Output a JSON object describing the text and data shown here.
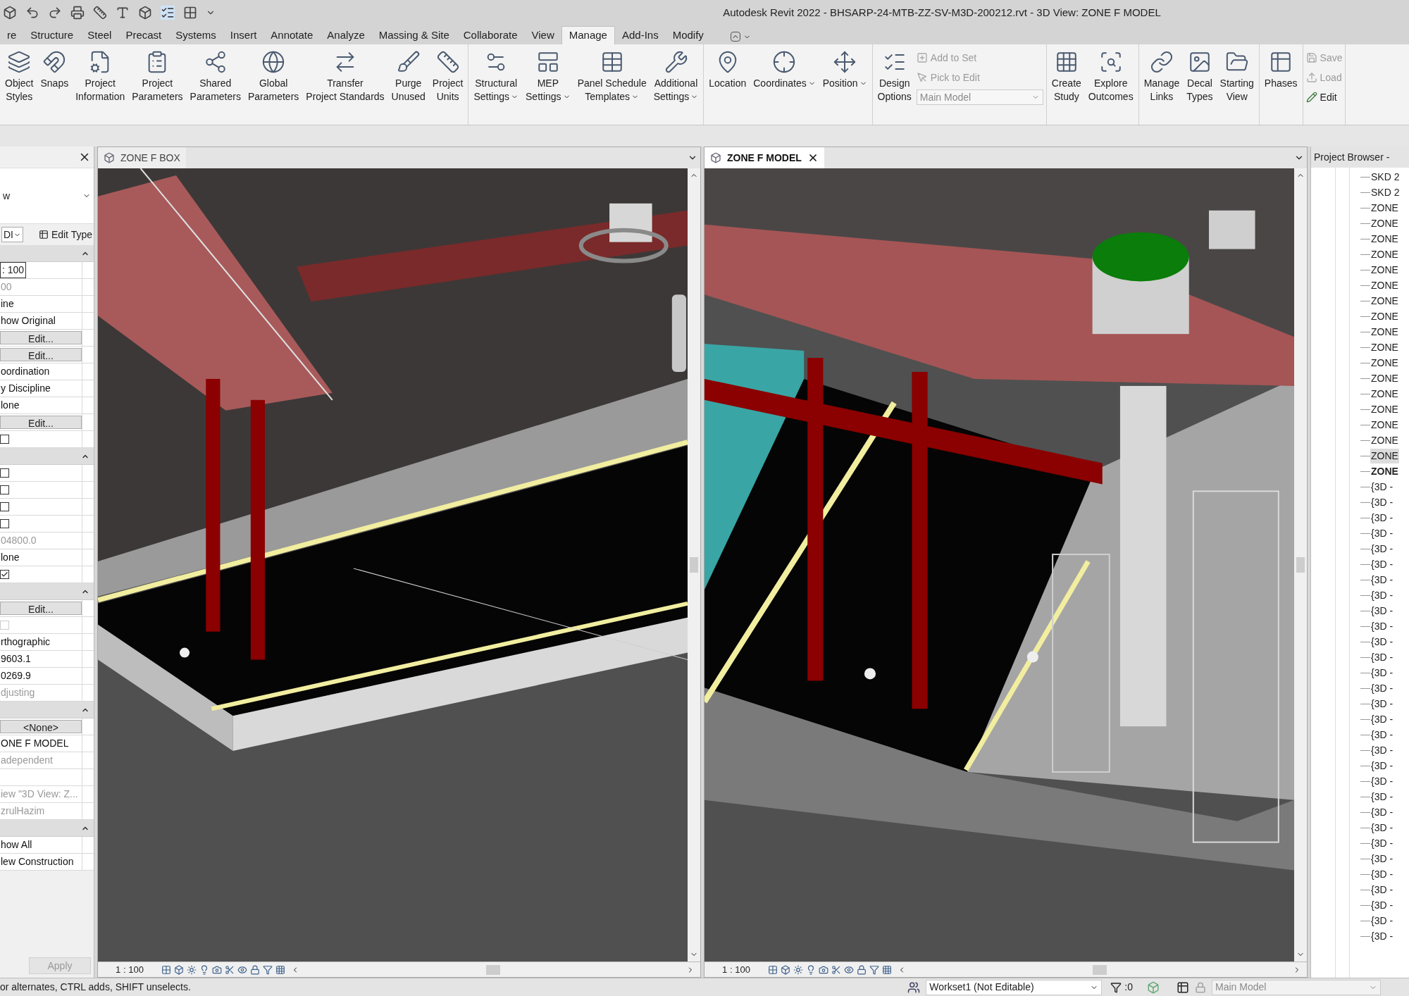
{
  "window": {
    "title": "Autodesk Revit 2022 - BHSARP-24-MTB-ZZ-SV-M3D-200212.rvt - 3D View: ZONE F MODEL"
  },
  "ribbon": {
    "tabs": [
      {
        "label": "re",
        "selected": false
      },
      {
        "label": "Structure",
        "selected": false
      },
      {
        "label": "Steel",
        "selected": false
      },
      {
        "label": "Precast",
        "selected": false
      },
      {
        "label": "Systems",
        "selected": false
      },
      {
        "label": "Insert",
        "selected": false
      },
      {
        "label": "Annotate",
        "selected": false
      },
      {
        "label": "Analyze",
        "selected": false
      },
      {
        "label": "Massing & Site",
        "selected": false
      },
      {
        "label": "Collaborate",
        "selected": false
      },
      {
        "label": "View",
        "selected": false
      },
      {
        "label": "Manage",
        "selected": true
      },
      {
        "label": "Add-Ins",
        "selected": false
      },
      {
        "label": "Modify",
        "selected": false
      }
    ],
    "panels": [
      {
        "items": [
          {
            "kind": "large",
            "lines": [
              "Object",
              "Styles"
            ],
            "dropdown": false
          },
          {
            "kind": "large",
            "lines": [
              "Snaps"
            ],
            "dropdown": false
          },
          {
            "kind": "large",
            "lines": [
              "Project",
              "Information"
            ],
            "dropdown": false
          },
          {
            "kind": "large",
            "lines": [
              "Project",
              "Parameters"
            ],
            "dropdown": false
          },
          {
            "kind": "large",
            "lines": [
              "Shared",
              "Parameters"
            ],
            "dropdown": false
          },
          {
            "kind": "large",
            "lines": [
              "Global",
              "Parameters"
            ],
            "dropdown": false
          },
          {
            "kind": "large",
            "lines": [
              "Transfer",
              "Project Standards"
            ],
            "dropdown": false
          },
          {
            "kind": "large",
            "lines": [
              "Purge",
              "Unused"
            ],
            "dropdown": false
          },
          {
            "kind": "large",
            "lines": [
              "Project",
              "Units"
            ],
            "dropdown": false
          }
        ]
      },
      {
        "items": [
          {
            "kind": "large",
            "lines": [
              "Structural",
              "Settings"
            ],
            "dropdown": true
          },
          {
            "kind": "large",
            "lines": [
              "MEP",
              "Settings"
            ],
            "dropdown": true
          },
          {
            "kind": "large",
            "lines": [
              "Panel Schedule",
              "Templates"
            ],
            "dropdown": true
          },
          {
            "kind": "large",
            "lines": [
              "Additional",
              "Settings"
            ],
            "dropdown": true
          }
        ]
      },
      {
        "items": [
          {
            "kind": "large",
            "lines": [
              "Location"
            ],
            "dropdown": false
          },
          {
            "kind": "large",
            "lines": [
              "Coordinates"
            ],
            "dropdown": true
          },
          {
            "kind": "large",
            "lines": [
              "Position"
            ],
            "dropdown": true
          }
        ]
      },
      {
        "items": [
          {
            "kind": "large",
            "lines": [
              "Design",
              "Options"
            ],
            "dropdown": false
          },
          {
            "kind": "small",
            "label": "Add to Set",
            "disabled": true
          },
          {
            "kind": "small",
            "label": "Pick to Edit",
            "disabled": true
          },
          {
            "kind": "select",
            "value": "Main Model",
            "disabled": true
          }
        ]
      },
      {
        "items": [
          {
            "kind": "large",
            "lines": [
              "Create",
              "Study"
            ],
            "dropdown": false
          },
          {
            "kind": "large",
            "lines": [
              "Explore",
              "Outcomes"
            ],
            "dropdown": false
          }
        ]
      },
      {
        "items": [
          {
            "kind": "large",
            "lines": [
              "Manage",
              "Links"
            ],
            "dropdown": false
          },
          {
            "kind": "large",
            "lines": [
              "Decal",
              "Types"
            ],
            "dropdown": false
          },
          {
            "kind": "large",
            "lines": [
              "Starting",
              "View"
            ],
            "dropdown": false
          }
        ]
      },
      {
        "items": [
          {
            "kind": "large",
            "lines": [
              "Phases"
            ],
            "dropdown": false
          }
        ]
      },
      {
        "items": [
          {
            "kind": "small",
            "label": "Save",
            "disabled": true
          },
          {
            "kind": "small",
            "label": "Load",
            "disabled": true
          },
          {
            "kind": "small",
            "label": "Edit",
            "disabled": false
          }
        ]
      }
    ]
  },
  "properties": {
    "type_selector": "w",
    "instance_selector": "DI",
    "edit_type": "Edit Type",
    "sections": [
      {
        "rows": [
          {
            "kind": "input",
            "value": ": 100"
          },
          {
            "kind": "text",
            "value": "00",
            "disabled": true
          },
          {
            "kind": "text",
            "value": "ine",
            "disabled": false
          },
          {
            "kind": "text",
            "value": "how Original",
            "disabled": false
          },
          {
            "kind": "button",
            "value": "Edit..."
          },
          {
            "kind": "button",
            "value": "Edit..."
          },
          {
            "kind": "text",
            "value": "oordination",
            "disabled": false
          },
          {
            "kind": "text",
            "value": "y Discipline",
            "disabled": false
          },
          {
            "kind": "text",
            "value": "lone",
            "disabled": false
          },
          {
            "kind": "button",
            "value": "Edit..."
          },
          {
            "kind": "checkbox",
            "checked": false,
            "disabled": false
          }
        ]
      },
      {
        "rows": [
          {
            "kind": "checkbox",
            "checked": false,
            "disabled": false
          },
          {
            "kind": "checkbox",
            "checked": false,
            "disabled": false
          },
          {
            "kind": "checkbox",
            "checked": false,
            "disabled": false
          },
          {
            "kind": "checkbox",
            "checked": false,
            "disabled": false
          },
          {
            "kind": "text",
            "value": "04800.0",
            "disabled": true
          },
          {
            "kind": "text",
            "value": "lone",
            "disabled": false
          },
          {
            "kind": "checkbox",
            "checked": true,
            "disabled": false
          }
        ]
      },
      {
        "rows": [
          {
            "kind": "button",
            "value": "Edit..."
          },
          {
            "kind": "checkbox",
            "checked": false,
            "disabled": true
          },
          {
            "kind": "text",
            "value": "rthographic",
            "disabled": false
          },
          {
            "kind": "text",
            "value": "9603.1",
            "disabled": false
          },
          {
            "kind": "text",
            "value": "0269.9",
            "disabled": false
          },
          {
            "kind": "text",
            "value": "djusting",
            "disabled": true
          }
        ]
      },
      {
        "rows": [
          {
            "kind": "button",
            "value": "<None>"
          },
          {
            "kind": "text",
            "value": "ONE F MODEL",
            "disabled": false
          },
          {
            "kind": "text",
            "value": "adependent",
            "disabled": true
          },
          {
            "kind": "empty"
          },
          {
            "kind": "text",
            "value": "iew \"3D View: Z...",
            "disabled": true
          },
          {
            "kind": "text",
            "value": "zrulHazim",
            "disabled": true
          }
        ]
      },
      {
        "rows": [
          {
            "kind": "text",
            "value": "how All",
            "disabled": false
          },
          {
            "kind": "text",
            "value": "lew Construction",
            "disabled": false
          }
        ]
      }
    ],
    "apply": {
      "label": "Apply",
      "disabled": true
    }
  },
  "views": [
    {
      "tab": "ZONE F BOX",
      "selected": false,
      "scale": "1 : 100"
    },
    {
      "tab": "ZONE F MODEL",
      "selected": true,
      "scale": "1 : 100"
    }
  ],
  "project_browser": {
    "title": "Project Browser -",
    "items": [
      {
        "label": "SKD 2",
        "selected": false,
        "active": false
      },
      {
        "label": "SKD 2",
        "selected": false,
        "active": false
      },
      {
        "label": "ZONE",
        "selected": false,
        "active": false
      },
      {
        "label": "ZONE",
        "selected": false,
        "active": false
      },
      {
        "label": "ZONE",
        "selected": false,
        "active": false
      },
      {
        "label": "ZONE",
        "selected": false,
        "active": false
      },
      {
        "label": "ZONE",
        "selected": false,
        "active": false
      },
      {
        "label": "ZONE",
        "selected": false,
        "active": false
      },
      {
        "label": "ZONE",
        "selected": false,
        "active": false
      },
      {
        "label": "ZONE",
        "selected": false,
        "active": false
      },
      {
        "label": "ZONE",
        "selected": false,
        "active": false
      },
      {
        "label": "ZONE",
        "selected": false,
        "active": false
      },
      {
        "label": "ZONE",
        "selected": false,
        "active": false
      },
      {
        "label": "ZONE",
        "selected": false,
        "active": false
      },
      {
        "label": "ZONE",
        "selected": false,
        "active": false
      },
      {
        "label": "ZONE",
        "selected": false,
        "active": false
      },
      {
        "label": "ZONE",
        "selected": false,
        "active": false
      },
      {
        "label": "ZONE",
        "selected": false,
        "active": false
      },
      {
        "label": "ZONE",
        "selected": true,
        "active": false
      },
      {
        "label": "ZONE",
        "selected": false,
        "active": true
      },
      {
        "label": "{3D -",
        "selected": false,
        "active": false
      },
      {
        "label": "{3D -",
        "selected": false,
        "active": false
      },
      {
        "label": "{3D -",
        "selected": false,
        "active": false
      },
      {
        "label": "{3D -",
        "selected": false,
        "active": false
      },
      {
        "label": "{3D -",
        "selected": false,
        "active": false
      },
      {
        "label": "{3D -",
        "selected": false,
        "active": false
      },
      {
        "label": "{3D -",
        "selected": false,
        "active": false
      },
      {
        "label": "{3D -",
        "selected": false,
        "active": false
      },
      {
        "label": "{3D -",
        "selected": false,
        "active": false
      },
      {
        "label": "{3D -",
        "selected": false,
        "active": false
      },
      {
        "label": "{3D -",
        "selected": false,
        "active": false
      },
      {
        "label": "{3D -",
        "selected": false,
        "active": false
      },
      {
        "label": "{3D -",
        "selected": false,
        "active": false
      },
      {
        "label": "{3D -",
        "selected": false,
        "active": false
      },
      {
        "label": "{3D -",
        "selected": false,
        "active": false
      },
      {
        "label": "{3D -",
        "selected": false,
        "active": false
      },
      {
        "label": "{3D -",
        "selected": false,
        "active": false
      },
      {
        "label": "{3D -",
        "selected": false,
        "active": false
      },
      {
        "label": "{3D -",
        "selected": false,
        "active": false
      },
      {
        "label": "{3D -",
        "selected": false,
        "active": false
      },
      {
        "label": "{3D -",
        "selected": false,
        "active": false
      },
      {
        "label": "{3D -",
        "selected": false,
        "active": false
      },
      {
        "label": "{3D -",
        "selected": false,
        "active": false
      },
      {
        "label": "{3D -",
        "selected": false,
        "active": false
      },
      {
        "label": "{3D -",
        "selected": false,
        "active": false
      },
      {
        "label": "{3D -",
        "selected": false,
        "active": false
      },
      {
        "label": "{3D -",
        "selected": false,
        "active": false
      },
      {
        "label": "{3D -",
        "selected": false,
        "active": false
      },
      {
        "label": "{3D -",
        "selected": false,
        "active": false
      },
      {
        "label": "{3D -",
        "selected": false,
        "active": false
      }
    ]
  },
  "status_bar": {
    "message": "or alternates, CTRL adds, SHIFT unselects.",
    "workset": "Workset1 (Not Editable)",
    "filter_count": ":0",
    "design_option": "Main Model"
  }
}
